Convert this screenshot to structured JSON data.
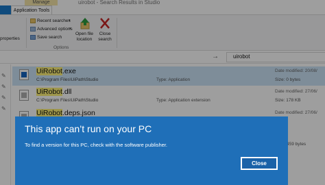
{
  "window": {
    "title": "uirobot - Search Results in Studio",
    "manage_tab": "Manage",
    "app_tools_tab": "Application Tools"
  },
  "ribbon": {
    "properties_label": "properties",
    "recent_searches": "Recent searches",
    "advanced_options": "Advanced options",
    "save_search": "Save search",
    "open_file_location": "Open file location",
    "close_search": "Close search",
    "group_options": "Options"
  },
  "search": {
    "value": "uirobot"
  },
  "results": [
    {
      "name_highlight": "UiRobot",
      "name_rest": ".exe",
      "path": "C:\\Program Files\\UiPath\\Studio",
      "type": "Type: Application",
      "date": "Date modified: 20/08/",
      "size": "Size: 0 bytes"
    },
    {
      "name_highlight": "UiRobot",
      "name_rest": ".dll",
      "path": "C:\\Program Files\\UiPath\\Studio",
      "type": "Type: Application extension",
      "date": "Date modified: 27/06/",
      "size": "Size: 178 KB"
    },
    {
      "name_highlight": "UiRobot",
      "name_rest": ".deps.json",
      "date": "Date modified: 27/06/"
    }
  ],
  "partial_size": "459 bytes",
  "dialog": {
    "title": "This app can’t run on your PC",
    "message": "To find a version for this PC, check with the software publisher.",
    "close_button": "Close"
  },
  "colors": {
    "dialog_bg": "#1f6fb8",
    "selection": "#cce4f7",
    "highlight": "#fff27a"
  }
}
